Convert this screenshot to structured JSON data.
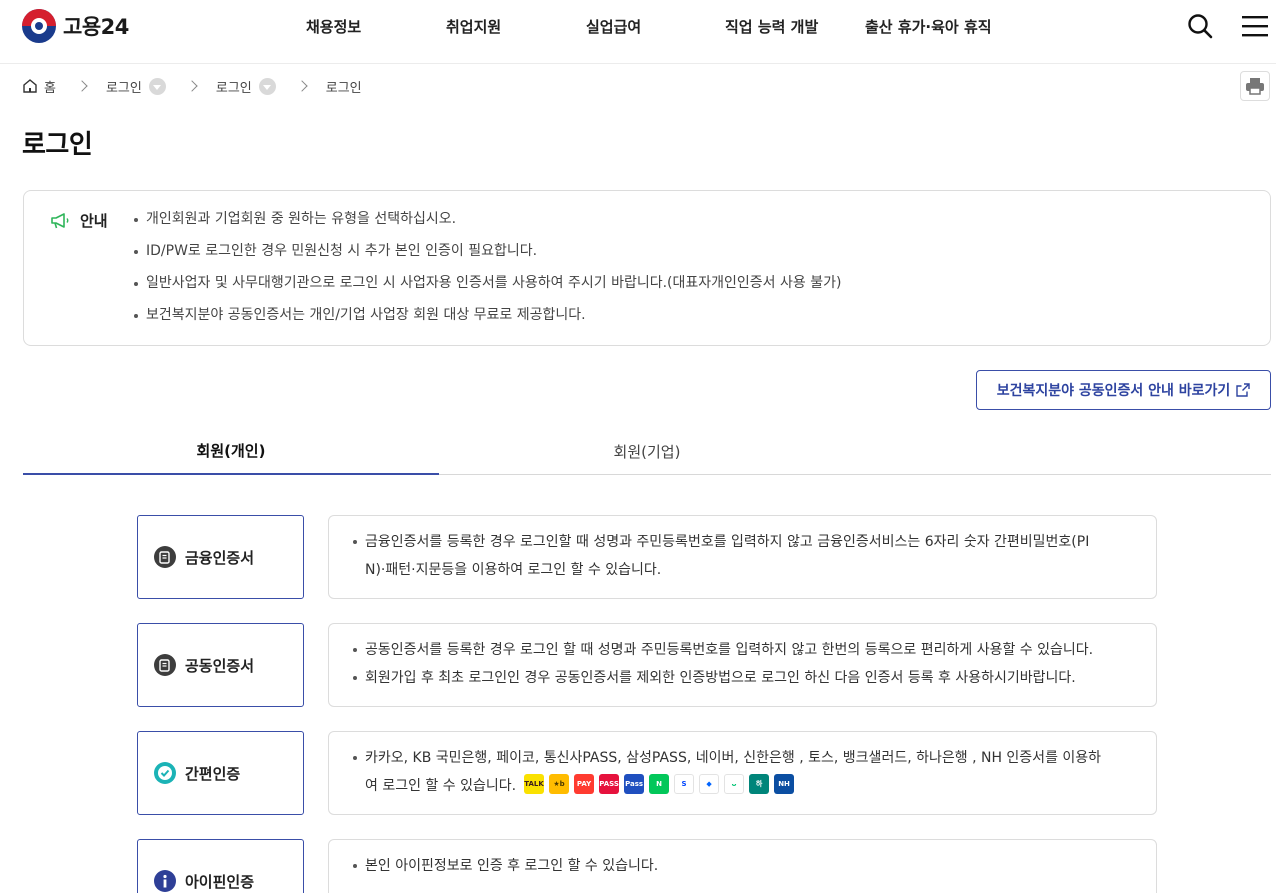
{
  "header": {
    "logo_text": "고용24",
    "nav": [
      "채용정보",
      "취업지원",
      "실업급여",
      "직업 능력 개발",
      "출산 휴가·육아 휴직"
    ]
  },
  "breadcrumb": {
    "home": "홈",
    "items": [
      "로그인",
      "로그인",
      "로그인"
    ]
  },
  "page_title": "로그인",
  "notice": {
    "label": "안내",
    "items": [
      "개인회원과 기업회원 중 원하는 유형을 선택하십시오.",
      "ID/PW로 로그인한 경우 민원신청 시 추가 본인 인증이 필요합니다.",
      "일반사업자 및 사무대행기관으로 로그인 시 사업자용 인증서를 사용하여 주시기 바랍니다.(대표자개인인증서 사용 불가)",
      "보건복지분야 공동인증서는 개인/기업 사업장 회원 대상 무료로 제공합니다."
    ]
  },
  "link_button": "보건복지분야 공동인증서 안내 바로가기",
  "tabs": [
    "회원(개인)",
    "회원(기업)"
  ],
  "methods": [
    {
      "label": "금융인증서",
      "icon": "certificate-icon",
      "icon_color": "#3d3d3d",
      "desc": [
        "금융인증서를 등록한 경우 로그인할 때 성명과 주민등록번호를 입력하지 않고 금융인증서비스는 6자리 숫자 간편비밀번호(PI",
        "N)·패턴·지문등을 이용하여 로그인 할 수 있습니다."
      ]
    },
    {
      "label": "공동인증서",
      "icon": "certificate-icon",
      "icon_color": "#3d3d3d",
      "desc": [
        "공동인증서를 등록한 경우 로그인 할 때 성명과 주민등록번호를 입력하지 않고 한번의 등록으로 편리하게 사용할 수 있습니다.",
        "회원가입 후 최초 로그인인 경우 공동인증서를 제외한 인증방법으로 로그인 하신 다음 인증서 등록 후 사용하시기바랍니다."
      ]
    },
    {
      "label": "간편인증",
      "icon": "check-circle-icon",
      "icon_color": "#1bb3b6",
      "desc": [
        "카카오, KB 국민은행, 페이코, 통신사PASS, 삼성PASS, 네이버, 신한은행 , 토스, 뱅크샐러드, 하나은행 , NH 인증서를 이용하",
        "여 로그인 할 수 있습니다."
      ]
    },
    {
      "label": "아이핀인증",
      "icon": "info-icon",
      "icon_color": "#2e3f97",
      "desc": [
        "본인 아이핀정보로 인증 후 로그인 할 수 있습니다."
      ]
    }
  ],
  "providers": [
    {
      "name": "kakao-icon",
      "color": "#fae100",
      "fg": "#3a1d1d",
      "text": "TALK"
    },
    {
      "name": "kb-icon",
      "color": "#ffbc00",
      "fg": "#4d3a00",
      "text": "★b"
    },
    {
      "name": "payco-icon",
      "color": "#ff3b30",
      "fg": "#ffffff",
      "text": "PAY"
    },
    {
      "name": "pass-icon",
      "color": "#e6123d",
      "fg": "#ffffff",
      "text": "PASS"
    },
    {
      "name": "samsung-pass-icon",
      "color": "#1f4fbf",
      "fg": "#ffffff",
      "text": "Pass"
    },
    {
      "name": "naver-icon",
      "color": "#03c75a",
      "fg": "#ffffff",
      "text": "N"
    },
    {
      "name": "shinhan-icon",
      "color": "#ffffff",
      "fg": "#0046ff",
      "text": "S"
    },
    {
      "name": "toss-icon",
      "color": "#ffffff",
      "fg": "#0064ff",
      "text": "◆"
    },
    {
      "name": "banksalad-icon",
      "color": "#ffffff",
      "fg": "#00c473",
      "text": "ᴗ"
    },
    {
      "name": "hana-icon",
      "color": "#00857a",
      "fg": "#ffffff",
      "text": "하"
    },
    {
      "name": "nh-icon",
      "color": "#0b4ea2",
      "fg": "#ffffff",
      "text": "NH"
    }
  ],
  "colors": {
    "accent": "#3a4ea8",
    "notice_icon": "#2fb55a"
  }
}
